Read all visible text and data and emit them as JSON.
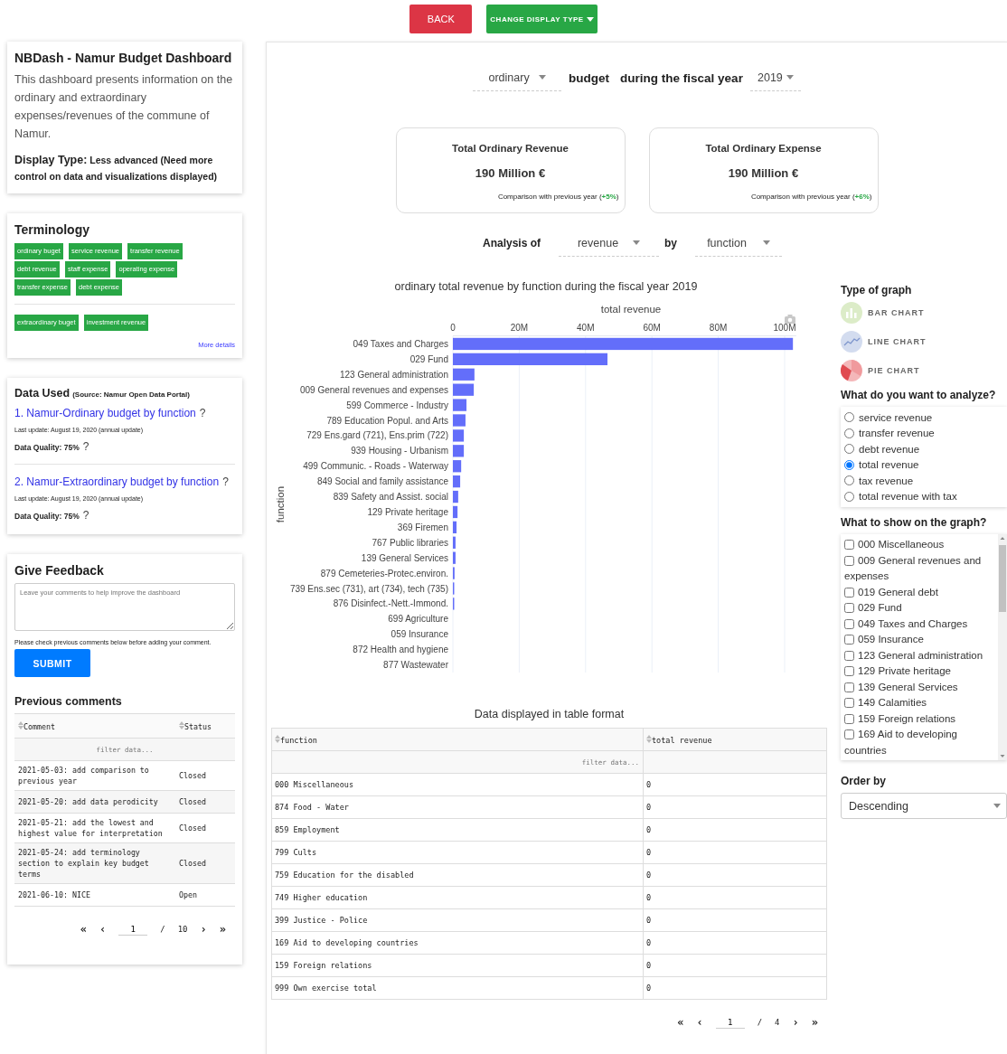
{
  "top_buttons": [
    {
      "label": "BACK",
      "kind": "back"
    },
    {
      "label": "CHANGE DISPLAY TYPE",
      "kind": "dropdown"
    }
  ],
  "intro": {
    "title": "NBDash - Namur Budget Dashboard",
    "description": "This dashboard presents information on the ordinary and extraordinary expenses/revenues of the commune of Namur.",
    "display_type_label": "Display Type:",
    "display_type_value": "Less advanced (Need more control on data and visualizations displayed)"
  },
  "terminology": {
    "title": "Terminology",
    "groups": [
      [
        "ordinary buget",
        "service revenue",
        "transfer revenue",
        "debt revenue",
        "staff expense",
        "operating expense",
        "transfer expense",
        "debt expense"
      ],
      [
        "extraordinary buget",
        "investment revenue"
      ]
    ],
    "more_link": "More details"
  },
  "data_used": {
    "title": "Data Used",
    "source": "(Source: Namur Open Data Portal)",
    "datasets": [
      {
        "link": "1. Namur-Ordinary budget by function",
        "help": "?",
        "last_update": "Last update: August 19, 2020 (annual update)",
        "quality": "Data Quality: 75%",
        "quality_help": "?"
      },
      {
        "link": "2. Namur-Extraordinary budget by function",
        "help": "?",
        "last_update": "Last update: August 19, 2020 (annual update)",
        "quality": "Data Quality: 75%",
        "quality_help": "?"
      }
    ]
  },
  "feedback": {
    "title": "Give Feedback",
    "placeholder": "Leave your comments to help improve the dashboard",
    "note": "Please check previous comments below before adding your comment.",
    "submit": "SUBMIT",
    "comments_title": "Previous comments",
    "columns": [
      "Comment",
      "Status"
    ],
    "filter_placeholder": "filter data...",
    "rows": [
      {
        "comment": "2021-05-03: add comparison to previous year",
        "status": "Closed"
      },
      {
        "comment": "2021-05-20: add data perodicity",
        "status": "Closed"
      },
      {
        "comment": "2021-05-21: add the lowest and highest value for interpretation",
        "status": "Closed"
      },
      {
        "comment": "2021-05-24: add terminology section to explain key budget terms",
        "status": "Closed"
      },
      {
        "comment": "2021-06-10: NICE",
        "status": "Open"
      }
    ],
    "pagination": {
      "first": "«",
      "prev": "‹",
      "page": "1",
      "separator": "/",
      "total": "10",
      "next": "›",
      "last": "»"
    }
  },
  "header": {
    "budget_type": "ordinary",
    "word_budget": "budget",
    "word_period": "during the fiscal year",
    "year": "2019"
  },
  "summary_cards": [
    {
      "title": "Total Ordinary Revenue",
      "value": "190 Million €",
      "comparison": "Comparison with previous year (",
      "change": "+5%",
      "comparison_end": ")"
    },
    {
      "title": "Total Ordinary Expense",
      "value": "190 Million €",
      "comparison": "Comparison with previous year (",
      "change": "+6%",
      "comparison_end": ")"
    }
  ],
  "analysis": {
    "label": "Analysis of",
    "measure": "revenue",
    "by": "by",
    "dimension": "function"
  },
  "chart": {
    "chart_data": {
      "type": "bar",
      "orientation": "h",
      "title": "ordinary total revenue by function during the fiscal year 2019",
      "xlabel": "total revenue",
      "ylabel": "function",
      "categories": [
        "049 Taxes and Charges",
        "029 Fund",
        "123 General administration",
        "009 General revenues and expenses",
        "599 Commerce - Industry",
        "789 Education Popul. and Arts",
        "729 Ens.gard (721), Ens.prim (722)",
        "939 Housing - Urbanism",
        "499 Communic. - Roads - Waterway",
        "849 Social and family assistance",
        "839 Safety and Assist. social",
        "129 Private heritage",
        "369 Firemen",
        "767 Public libraries",
        "139 General Services",
        "879 Cemeteries-Protec.environ.",
        "739 Ens.sec (731), art (734), tech (735)",
        "876 Disinfect.-Nett.-Immond.",
        "699 Agriculture",
        "059 Insurance",
        "872 Health and hygiene",
        "877 Wastewater"
      ],
      "grid": true,
      "xlim": [
        0,
        103.5
      ],
      "series": [
        {
          "color": "#636efa",
          "values": [
            102.5,
            46.6,
            6.5,
            6.3,
            4.1,
            3.8,
            3.3,
            3.3,
            2.5,
            2.2,
            1.6,
            1.4,
            1.1,
            0.8,
            0.8,
            0.5,
            0.4,
            0.4,
            0,
            0,
            0,
            0
          ]
        }
      ],
      "xticks": [
        {
          "value": 0,
          "label": "0"
        },
        {
          "value": 20,
          "label": "20M"
        },
        {
          "value": 40,
          "label": "40M"
        },
        {
          "value": 60,
          "label": "60M"
        },
        {
          "value": 80,
          "label": "80M"
        },
        {
          "value": 100,
          "label": "100M"
        }
      ]
    }
  },
  "right_panel": {
    "graph_type_title": "Type of graph",
    "graph_types": [
      {
        "label": "BAR CHART",
        "kind": "bar"
      },
      {
        "label": "LINE CHART",
        "kind": "line"
      },
      {
        "label": "PIE CHART",
        "kind": "pie"
      }
    ],
    "analyze_title": "What do you want to analyze?",
    "analyze_options": [
      {
        "label": "service revenue",
        "selected": false
      },
      {
        "label": "transfer revenue",
        "selected": false
      },
      {
        "label": "debt revenue",
        "selected": false
      },
      {
        "label": "total revenue",
        "selected": true
      },
      {
        "label": "tax revenue",
        "selected": false
      },
      {
        "label": "total revenue with tax",
        "selected": false
      }
    ],
    "show_title": "What to show on the graph?",
    "show_options": [
      {
        "label": "000 Miscellaneous",
        "checked": false
      },
      {
        "label": "009 General revenues and expenses",
        "checked": false
      },
      {
        "label": "019 General debt",
        "checked": false
      },
      {
        "label": "029 Fund",
        "checked": false
      },
      {
        "label": "049 Taxes and Charges",
        "checked": false
      },
      {
        "label": "059 Insurance",
        "checked": false
      },
      {
        "label": "123 General administration",
        "checked": false
      },
      {
        "label": "129 Private heritage",
        "checked": false
      },
      {
        "label": "139 General Services",
        "checked": false
      },
      {
        "label": "149 Calamities",
        "checked": false
      },
      {
        "label": "159 Foreign relations",
        "checked": false
      },
      {
        "label": "169 Aid to developing countries",
        "checked": false
      }
    ],
    "order_title": "Order by",
    "order_value": "Descending"
  },
  "data_table": {
    "title": "Data displayed in table format",
    "columns": [
      "function",
      "total revenue"
    ],
    "filter_placeholder": "filter data...",
    "rows": [
      [
        "000 Miscellaneous",
        "0"
      ],
      [
        "874 Food - Water",
        "0"
      ],
      [
        "859 Employment",
        "0"
      ],
      [
        "799 Cults",
        "0"
      ],
      [
        "759 Education for the disabled",
        "0"
      ],
      [
        "749 Higher education",
        "0"
      ],
      [
        "399 Justice - Police",
        "0"
      ],
      [
        "169 Aid to developing countries",
        "0"
      ],
      [
        "159 Foreign relations",
        "0"
      ],
      [
        "999 Own exercise total",
        "0"
      ]
    ],
    "pagination": {
      "first": "«",
      "prev": "‹",
      "page": "1",
      "separator": "/",
      "total": "4",
      "next": "›",
      "last": "»"
    }
  }
}
